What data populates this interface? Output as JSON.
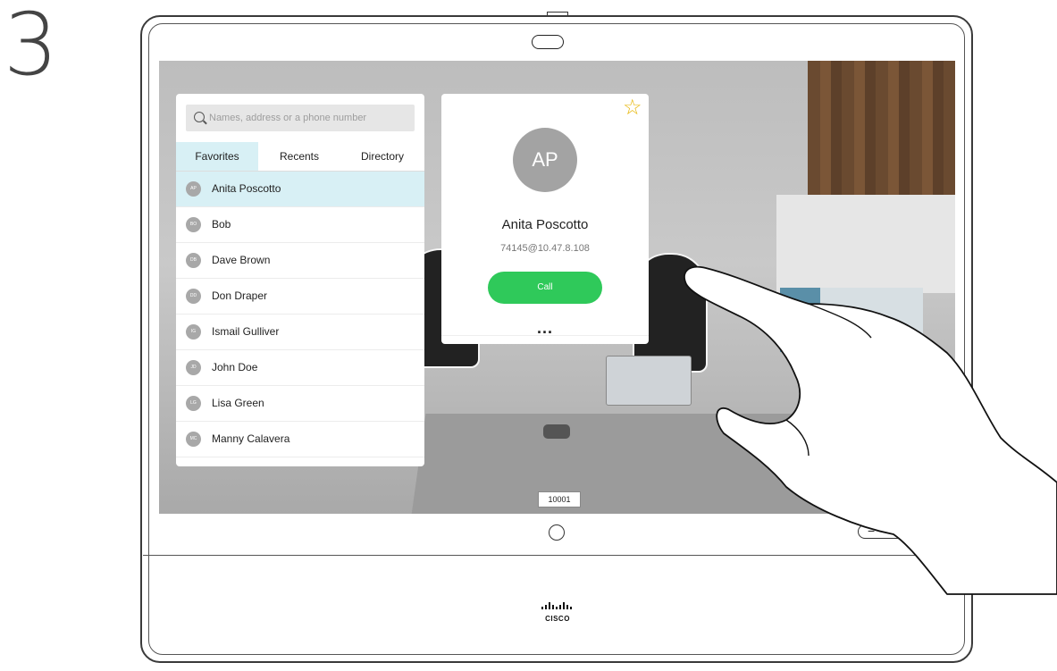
{
  "step_number": "3",
  "search": {
    "placeholder": "Names, address or a phone number"
  },
  "tabs": [
    {
      "label": "Favorites",
      "active": true
    },
    {
      "label": "Recents",
      "active": false
    },
    {
      "label": "Directory",
      "active": false
    }
  ],
  "contacts": [
    {
      "initials": "AP",
      "name": "Anita Poscotto",
      "selected": true
    },
    {
      "initials": "BO",
      "name": "Bob",
      "selected": false
    },
    {
      "initials": "DB",
      "name": "Dave Brown",
      "selected": false
    },
    {
      "initials": "DD",
      "name": "Don Draper",
      "selected": false
    },
    {
      "initials": "IG",
      "name": "Ismail Gulliver",
      "selected": false
    },
    {
      "initials": "JD",
      "name": "John Doe",
      "selected": false
    },
    {
      "initials": "LG",
      "name": "Lisa Green",
      "selected": false
    },
    {
      "initials": "MC",
      "name": "Manny Calavera",
      "selected": false
    }
  ],
  "detail": {
    "initials": "AP",
    "name": "Anita Poscotto",
    "address": "74145@10.47.8.108",
    "call_label": "Call",
    "more_label": "...",
    "favorite_icon": "star-outline-icon"
  },
  "room": {
    "conference_id": "10001"
  },
  "device": {
    "volume_minus": "−",
    "volume_plus": "+",
    "brand": "CISCO"
  },
  "colors": {
    "accent_green": "#2fc95a",
    "selection_bg": "#d8f0f5",
    "star": "#e7b70a"
  }
}
